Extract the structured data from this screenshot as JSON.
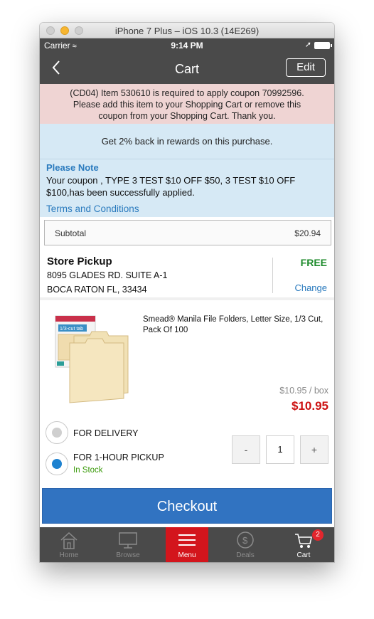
{
  "window": {
    "title": "iPhone 7 Plus – iOS 10.3 (14E269)"
  },
  "status_bar": {
    "carrier": "Carrier",
    "time": "9:14 PM"
  },
  "nav": {
    "back_icon": "chevron-left-icon",
    "title": "Cart",
    "edit_label": "Edit"
  },
  "error": {
    "lines": [
      "(CD04) Item 530610 is required to apply coupon 70992596.",
      "Please add this item to your Shopping Cart or remove this",
      "coupon from your Shopping Cart.  Thank you."
    ]
  },
  "rewards": {
    "text": "Get 2% back in rewards on this purchase."
  },
  "note": {
    "heading": "Please Note",
    "body": "Your coupon , TYPE 3 TEST $10 OFF $50, 3 TEST $10 OFF $100,has been successfully applied.",
    "terms_link": "Terms and Conditions"
  },
  "subtotal": {
    "label": "Subtotal",
    "value": "$20.94"
  },
  "store_pickup": {
    "title": "Store Pickup",
    "address_line1": "8095 GLADES RD. SUITE A-1",
    "address_line2": "BOCA RATON FL, 33434",
    "cost": "FREE",
    "change_label": "Change"
  },
  "product": {
    "name": "Smead® Manila File Folders, Letter Size, 1/3 Cut, Pack Of 100",
    "unit_price": "$10.95 / box",
    "price": "$10.95",
    "image_label": "1/3-cut tab"
  },
  "fulfillment": {
    "delivery_label": "FOR DELIVERY",
    "pickup_label": "FOR 1-HOUR PICKUP",
    "stock_status": "In Stock",
    "selected": "pickup"
  },
  "quantity": {
    "minus": "-",
    "value": "1",
    "plus": "+"
  },
  "checkout_label": "Checkout",
  "tabs": [
    {
      "label": "Home",
      "icon": "home-icon"
    },
    {
      "label": "Browse",
      "icon": "monitor-icon"
    },
    {
      "label": "Menu",
      "icon": "hamburger-icon"
    },
    {
      "label": "Deals",
      "icon": "dollar-icon"
    },
    {
      "label": "Cart",
      "icon": "cart-icon",
      "badge": "2"
    }
  ],
  "colors": {
    "nav_bg": "#4a4a4a",
    "error_bg": "#efd4d3",
    "info_bg": "#d6e9f5",
    "link": "#2b7bbe",
    "price": "#cc1010",
    "free": "#1c8a2a",
    "checkout": "#3173c1",
    "menu_tab": "#d3151c"
  }
}
